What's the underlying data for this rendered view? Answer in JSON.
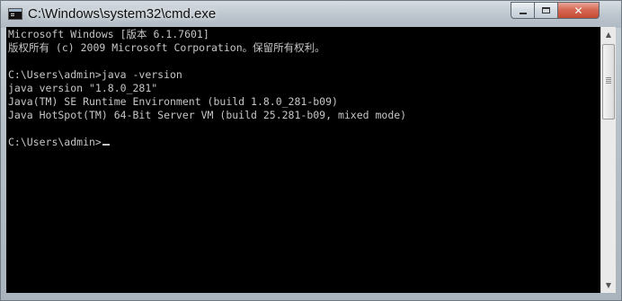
{
  "window": {
    "title": "C:\\Windows\\system32\\cmd.exe",
    "close_symbol": "✕"
  },
  "console": {
    "lines": [
      "Microsoft Windows [版本 6.1.7601]",
      "版权所有 (c) 2009 Microsoft Corporation。保留所有权利。",
      "",
      "C:\\Users\\admin>java -version",
      "java version \"1.8.0_281\"",
      "Java(TM) SE Runtime Environment (build 1.8.0_281-b09)",
      "Java HotSpot(TM) 64-Bit Server VM (build 25.281-b09, mixed mode)",
      "",
      "C:\\Users\\admin>"
    ],
    "colors": {
      "background": "#000000",
      "text": "#c6c6c6"
    }
  },
  "scrollbar": {
    "up_arrow": "▲",
    "down_arrow": "▼"
  }
}
